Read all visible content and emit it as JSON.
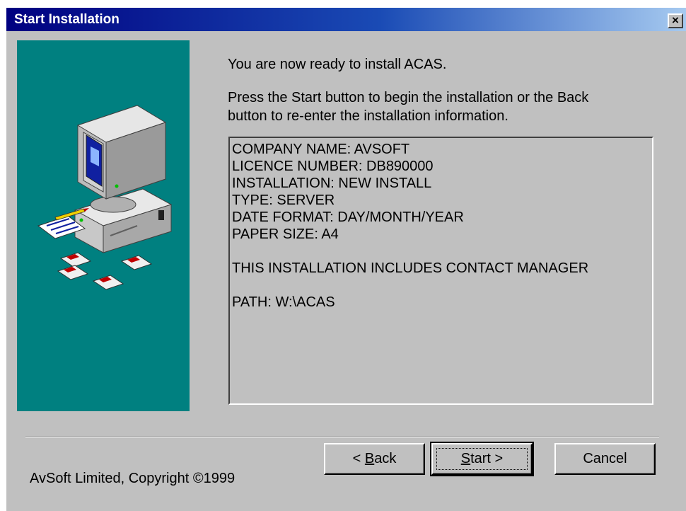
{
  "window": {
    "title": "Start Installation",
    "close_glyph": "×"
  },
  "colors": {
    "titlebar_start": "#000080",
    "titlebar_end": "#a6caf0",
    "dialog_bg": "#c0c0c0",
    "side_panel": "#008080"
  },
  "side_panel": {
    "icons": [
      "computer-icon",
      "document-icon",
      "floppy-disk-icon"
    ]
  },
  "main": {
    "intro": "You are now ready to install  ACAS.",
    "instructions_line1": "Press the Start button to begin the installation or the Back",
    "instructions_line2": "button to re-enter the installation information."
  },
  "summary": {
    "lines": [
      "COMPANY NAME:  AVSOFT",
      "LICENCE NUMBER:  DB890000",
      "INSTALLATION:  NEW INSTALL",
      "TYPE:  SERVER",
      "DATE FORMAT: DAY/MONTH/YEAR",
      "PAPER SIZE: A4",
      "",
      "THIS INSTALLATION INCLUDES CONTACT MANAGER",
      "",
      "PATH: W:\\ACAS"
    ]
  },
  "footer": {
    "copyright": "AvSoft Limited, Copyright ©1999",
    "back_prefix": "< ",
    "back_key": "B",
    "back_rest": "ack",
    "start_key": "S",
    "start_rest": "tart >",
    "cancel_label": "Cancel"
  }
}
